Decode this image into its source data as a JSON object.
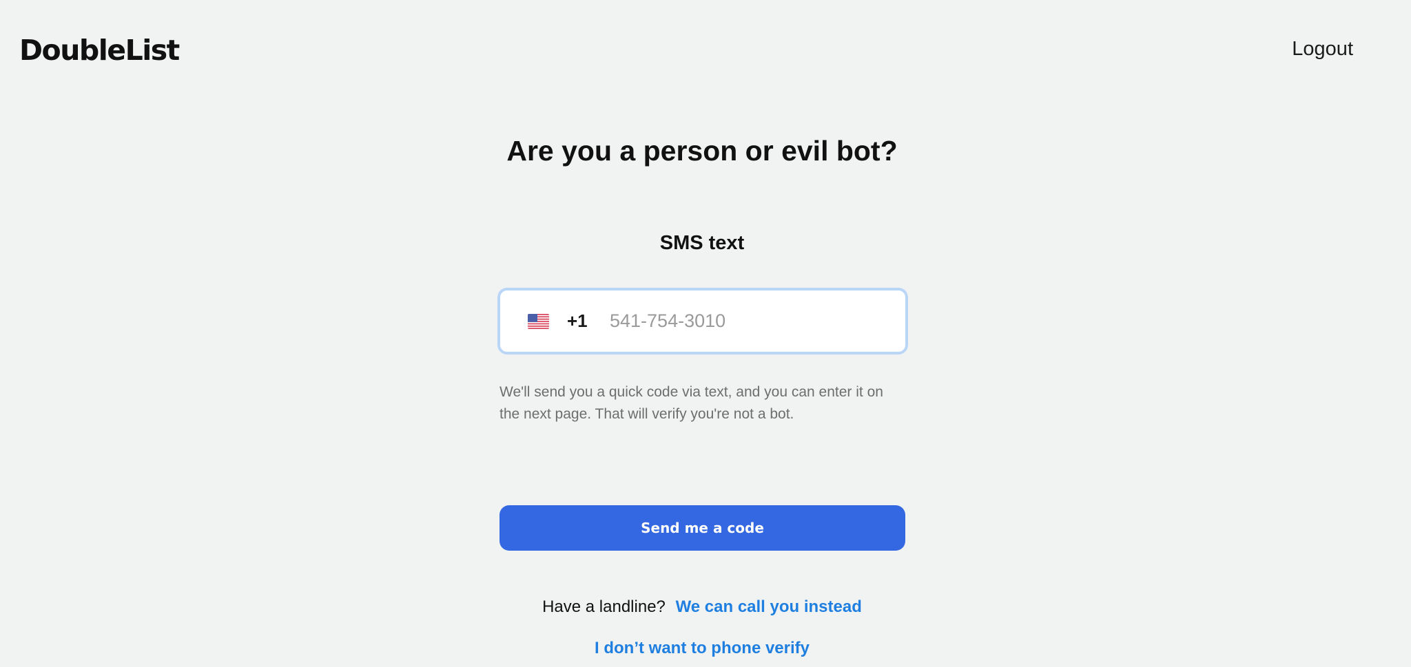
{
  "header": {
    "logo_text": "DoubleList",
    "logout_label": "Logout"
  },
  "main": {
    "title": "Are you a person or evil bot?",
    "method_label": "SMS text",
    "phone": {
      "country_flag_icon": "us-flag-icon",
      "dial_code": "+1",
      "value": "",
      "placeholder": "541-754-3010"
    },
    "helper_text": "We'll send you a quick code via text, and you can enter it on the next page. That will verify you're not a bot.",
    "send_button_label": "Send me a code",
    "landline_prompt": "Have a landline?",
    "call_link_label": "We can call you instead",
    "skip_link_label": "I don’t want to phone verify"
  },
  "colors": {
    "background": "#f1f3f3",
    "primary_button": "#3467e2",
    "link": "#1f7fe0",
    "input_focus_border": "#b9d6f6",
    "helper_text": "#6d6d6d"
  }
}
